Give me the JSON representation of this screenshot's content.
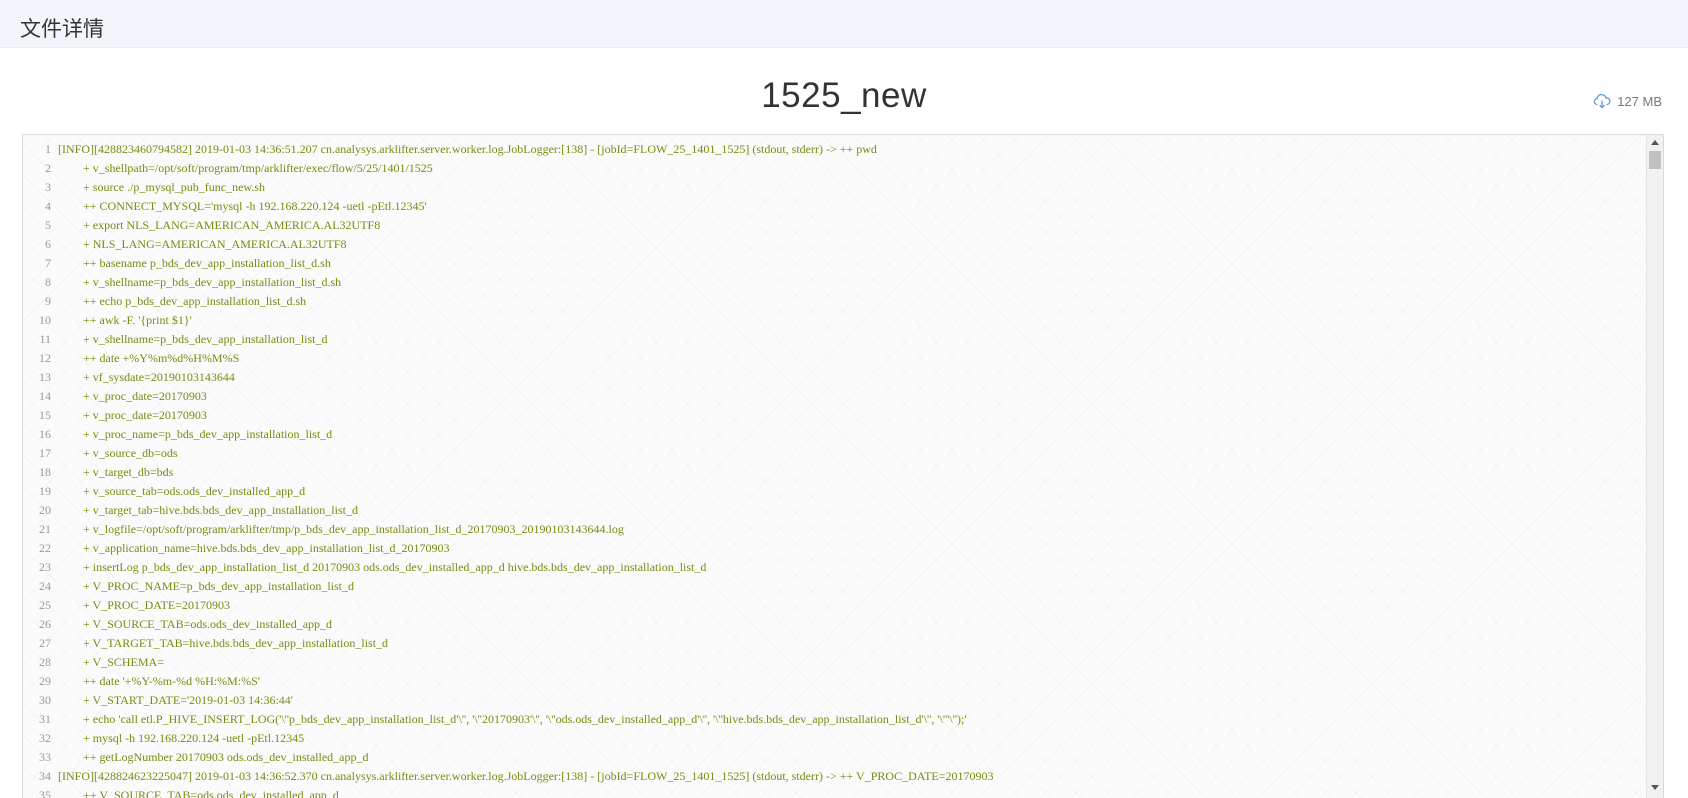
{
  "header": {
    "title": "文件详情"
  },
  "file": {
    "name": "1525_new",
    "size": "127 MB"
  },
  "icons": {
    "download": "cloud-download-icon"
  },
  "colors": {
    "log_text": "#7a8a10",
    "line_number": "#999999",
    "header_bg": "#f2f6fa",
    "download_icon": "#5b9bd5"
  },
  "log": {
    "lines": [
      {
        "n": "1",
        "text": "[INFO][428823460794582] 2019-01-03 14:36:51.207 cn.analysys.arklifter.server.worker.log.JobLogger:[138] - [jobId=FLOW_25_1401_1525] (stdout, stderr) -> ++ pwd",
        "indent": false
      },
      {
        "n": "2",
        "text": "+ v_shellpath=/opt/soft/program/tmp/arklifter/exec/flow/5/25/1401/1525",
        "indent": true
      },
      {
        "n": "3",
        "text": "+ source ./p_mysql_pub_func_new.sh",
        "indent": true
      },
      {
        "n": "4",
        "text": "++ CONNECT_MYSQL='mysql -h 192.168.220.124 -uetl -pEtl.12345'",
        "indent": true
      },
      {
        "n": "5",
        "text": "+ export NLS_LANG=AMERICAN_AMERICA.AL32UTF8",
        "indent": true
      },
      {
        "n": "6",
        "text": "+ NLS_LANG=AMERICAN_AMERICA.AL32UTF8",
        "indent": true
      },
      {
        "n": "7",
        "text": "++ basename p_bds_dev_app_installation_list_d.sh",
        "indent": true
      },
      {
        "n": "8",
        "text": "+ v_shellname=p_bds_dev_app_installation_list_d.sh",
        "indent": true
      },
      {
        "n": "9",
        "text": "++ echo p_bds_dev_app_installation_list_d.sh",
        "indent": true
      },
      {
        "n": "10",
        "text": "++ awk -F. '{print $1}'",
        "indent": true
      },
      {
        "n": "11",
        "text": "+ v_shellname=p_bds_dev_app_installation_list_d",
        "indent": true
      },
      {
        "n": "12",
        "text": "++ date +%Y%m%d%H%M%S",
        "indent": true
      },
      {
        "n": "13",
        "text": "+ vf_sysdate=20190103143644",
        "indent": true
      },
      {
        "n": "14",
        "text": "+ v_proc_date=20170903",
        "indent": true
      },
      {
        "n": "15",
        "text": "+ v_proc_date=20170903",
        "indent": true
      },
      {
        "n": "16",
        "text": "+ v_proc_name=p_bds_dev_app_installation_list_d",
        "indent": true
      },
      {
        "n": "17",
        "text": "+ v_source_db=ods",
        "indent": true
      },
      {
        "n": "18",
        "text": "+ v_target_db=bds",
        "indent": true
      },
      {
        "n": "19",
        "text": "+ v_source_tab=ods.ods_dev_installed_app_d",
        "indent": true
      },
      {
        "n": "20",
        "text": "+ v_target_tab=hive.bds.bds_dev_app_installation_list_d",
        "indent": true
      },
      {
        "n": "21",
        "text": "+ v_logfile=/opt/soft/program/arklifter/tmp/p_bds_dev_app_installation_list_d_20170903_20190103143644.log",
        "indent": true
      },
      {
        "n": "22",
        "text": "+ v_application_name=hive.bds.bds_dev_app_installation_list_d_20170903",
        "indent": true
      },
      {
        "n": "23",
        "text": "+ insertLog p_bds_dev_app_installation_list_d 20170903 ods.ods_dev_installed_app_d hive.bds.bds_dev_app_installation_list_d",
        "indent": true
      },
      {
        "n": "24",
        "text": "+ V_PROC_NAME=p_bds_dev_app_installation_list_d",
        "indent": true
      },
      {
        "n": "25",
        "text": "+ V_PROC_DATE=20170903",
        "indent": true
      },
      {
        "n": "26",
        "text": "+ V_SOURCE_TAB=ods.ods_dev_installed_app_d",
        "indent": true
      },
      {
        "n": "27",
        "text": "+ V_TARGET_TAB=hive.bds.bds_dev_app_installation_list_d",
        "indent": true
      },
      {
        "n": "28",
        "text": "+ V_SCHEMA=",
        "indent": true
      },
      {
        "n": "29",
        "text": "++ date '+%Y-%m-%d %H:%M:%S'",
        "indent": true
      },
      {
        "n": "30",
        "text": "+ V_START_DATE='2019-01-03 14:36:44'",
        "indent": true
      },
      {
        "n": "31",
        "text": "+ echo 'call etl.P_HIVE_INSERT_LOG('\\''p_bds_dev_app_installation_list_d'\\'', '\\''20170903'\\'', '\\''ods.ods_dev_installed_app_d'\\'', '\\''hive.bds.bds_dev_app_installation_list_d'\\'', '\\'''\\'');'",
        "indent": true
      },
      {
        "n": "32",
        "text": "+ mysql -h 192.168.220.124 -uetl -pEtl.12345",
        "indent": true
      },
      {
        "n": "33",
        "text": "++ getLogNumber 20170903 ods.ods_dev_installed_app_d",
        "indent": true
      },
      {
        "n": "34",
        "text": "[INFO][428824623225047] 2019-01-03 14:36:52.370 cn.analysys.arklifter.server.worker.log.JobLogger:[138] - [jobId=FLOW_25_1401_1525] (stdout, stderr) -> ++ V_PROC_DATE=20170903",
        "indent": false
      },
      {
        "n": "35",
        "text": "++ V_SOURCE_TAB=ods.ods_dev_installed_app_d",
        "indent": true
      }
    ]
  }
}
